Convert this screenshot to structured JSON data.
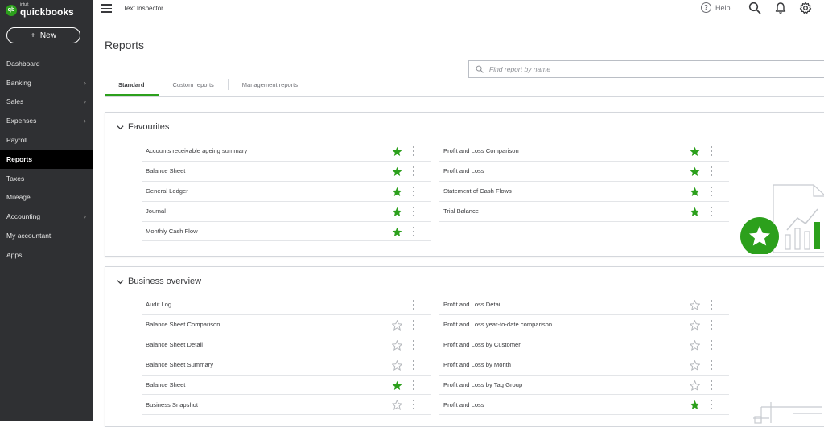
{
  "brand": {
    "intuit": "intuit",
    "name": "quickbooks",
    "badge": "qb"
  },
  "sidebar": {
    "new_label": "New",
    "items": [
      {
        "label": "Dashboard",
        "chevron": false,
        "active": false
      },
      {
        "label": "Banking",
        "chevron": true,
        "active": false
      },
      {
        "label": "Sales",
        "chevron": true,
        "active": false
      },
      {
        "label": "Expenses",
        "chevron": true,
        "active": false
      },
      {
        "label": "Payroll",
        "chevron": false,
        "active": false
      },
      {
        "label": "Reports",
        "chevron": false,
        "active": true
      },
      {
        "label": "Taxes",
        "chevron": false,
        "active": false
      },
      {
        "label": "Mileage",
        "chevron": false,
        "active": false
      },
      {
        "label": "Accounting",
        "chevron": true,
        "active": false
      },
      {
        "label": "My accountant",
        "chevron": false,
        "active": false
      },
      {
        "label": "Apps",
        "chevron": false,
        "active": false
      }
    ]
  },
  "topbar": {
    "company": "Text Inspector",
    "help_label": "Help",
    "icons": [
      "help-icon",
      "search-icon",
      "bell-icon",
      "gear-icon"
    ]
  },
  "page": {
    "title": "Reports"
  },
  "search": {
    "placeholder": "Find report by name",
    "value": ""
  },
  "tabs": [
    {
      "label": "Standard",
      "active": true
    },
    {
      "label": "Custom reports",
      "active": false
    },
    {
      "label": "Management reports",
      "active": false
    }
  ],
  "colors": {
    "accent": "#2ca01c",
    "sidebar": "#2f3033",
    "text": "#393a3d",
    "star_empty": "#b4b7bc"
  },
  "sections": [
    {
      "title": "Favourites",
      "left": [
        {
          "label": "Accounts receivable ageing summary",
          "starred": true
        },
        {
          "label": "Balance Sheet",
          "starred": true
        },
        {
          "label": "General Ledger",
          "starred": true
        },
        {
          "label": "Journal",
          "starred": true
        },
        {
          "label": "Monthly Cash Flow",
          "starred": true
        }
      ],
      "right": [
        {
          "label": "Profit and Loss Comparison",
          "starred": true
        },
        {
          "label": "Profit and Loss",
          "starred": true
        },
        {
          "label": "Statement of Cash Flows",
          "starred": true
        },
        {
          "label": "Trial Balance",
          "starred": true
        }
      ]
    },
    {
      "title": "Business overview",
      "left": [
        {
          "label": "Audit Log",
          "starred": null
        },
        {
          "label": "Balance Sheet Comparison",
          "starred": false
        },
        {
          "label": "Balance Sheet Detail",
          "starred": false
        },
        {
          "label": "Balance Sheet Summary",
          "starred": false
        },
        {
          "label": "Balance Sheet",
          "starred": true
        },
        {
          "label": "Business Snapshot",
          "starred": false
        }
      ],
      "right": [
        {
          "label": "Profit and Loss Detail",
          "starred": false
        },
        {
          "label": "Profit and Loss year-to-date comparison",
          "starred": false
        },
        {
          "label": "Profit and Loss by Customer",
          "starred": false
        },
        {
          "label": "Profit and Loss by Month",
          "starred": false
        },
        {
          "label": "Profit and Loss by Tag Group",
          "starred": false
        },
        {
          "label": "Profit and Loss",
          "starred": true
        }
      ]
    }
  ]
}
